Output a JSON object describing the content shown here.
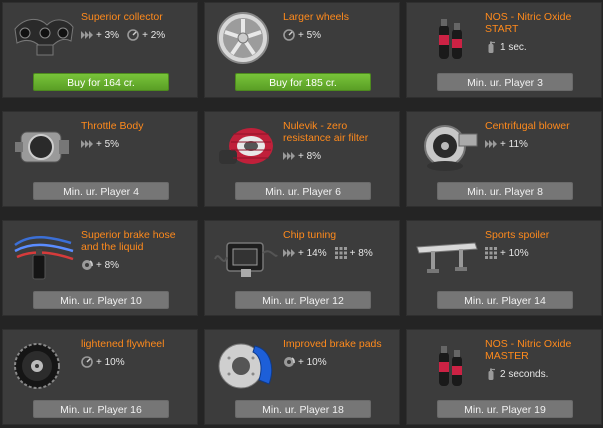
{
  "colors": {
    "background": "#242424",
    "card": "#3c3c3c",
    "title": "#ff8a1c",
    "buy_button": "#6ab230",
    "level_button": "#767676"
  },
  "cards": [
    {
      "title": "Superior collector",
      "image": "exhaust-manifold-image",
      "stats": [
        {
          "icon": "acceleration-icon",
          "value": "+ 3%"
        },
        {
          "icon": "speedometer-icon",
          "value": "+ 2%"
        }
      ],
      "button": {
        "type": "buy",
        "label": "Buy for 164 cr."
      }
    },
    {
      "title": "Larger wheels",
      "image": "alloy-wheel-image",
      "stats": [
        {
          "icon": "speedometer-icon",
          "value": "+ 5%"
        }
      ],
      "button": {
        "type": "buy",
        "label": "Buy for 185 cr."
      }
    },
    {
      "title": "NOS - Nitric Oxide START",
      "image": "nitro-bottles-image",
      "stats": [
        {
          "icon": "extinguisher-icon",
          "value": "1 sec."
        }
      ],
      "button": {
        "type": "level",
        "label": "Min. ur. Player 3"
      }
    },
    {
      "title": "Throttle Body",
      "image": "throttle-body-image",
      "stats": [
        {
          "icon": "acceleration-icon",
          "value": "+ 5%"
        }
      ],
      "button": {
        "type": "level",
        "label": "Min. ur. Player 4"
      }
    },
    {
      "title": "Nulevik - zero resistance air filter",
      "image": "air-filter-image",
      "stats": [
        {
          "icon": "acceleration-icon",
          "value": "+ 8%"
        }
      ],
      "button": {
        "type": "level",
        "label": "Min. ur. Player 6"
      }
    },
    {
      "title": "Centrifugal blower",
      "image": "turbo-blower-image",
      "stats": [
        {
          "icon": "acceleration-icon",
          "value": "+ 11%"
        }
      ],
      "button": {
        "type": "level",
        "label": "Min. ur. Player 8"
      }
    },
    {
      "title": "Superior brake hose and the liquid",
      "image": "brake-hoses-image",
      "stats": [
        {
          "icon": "brake-disc-icon",
          "value": "+ 8%"
        }
      ],
      "button": {
        "type": "level",
        "label": "Min. ur. Player 10"
      }
    },
    {
      "title": "Chip tuning",
      "image": "chip-tuning-image",
      "stats": [
        {
          "icon": "acceleration-icon",
          "value": "+ 14%"
        },
        {
          "icon": "grip-icon",
          "value": "+ 8%"
        }
      ],
      "button": {
        "type": "level",
        "label": "Min. ur. Player 12"
      }
    },
    {
      "title": "Sports spoiler",
      "image": "spoiler-image",
      "stats": [
        {
          "icon": "grip-icon",
          "value": "+ 10%"
        }
      ],
      "button": {
        "type": "level",
        "label": "Min. ur. Player 14"
      }
    },
    {
      "title": "lightened flywheel",
      "image": "flywheel-image",
      "stats": [
        {
          "icon": "speedometer-icon",
          "value": "+ 10%"
        }
      ],
      "button": {
        "type": "level",
        "label": "Min. ur. Player 16"
      }
    },
    {
      "title": "Improved brake pads",
      "image": "brake-caliper-image",
      "stats": [
        {
          "icon": "brake-disc-icon",
          "value": "+ 10%"
        }
      ],
      "button": {
        "type": "level",
        "label": "Min. ur. Player 18"
      }
    },
    {
      "title": "NOS - Nitric Oxide MASTER",
      "image": "nitro-bottles-image",
      "stats": [
        {
          "icon": "extinguisher-icon",
          "value": "2 seconds."
        }
      ],
      "button": {
        "type": "level",
        "label": "Min. ur. Player 19"
      }
    }
  ]
}
